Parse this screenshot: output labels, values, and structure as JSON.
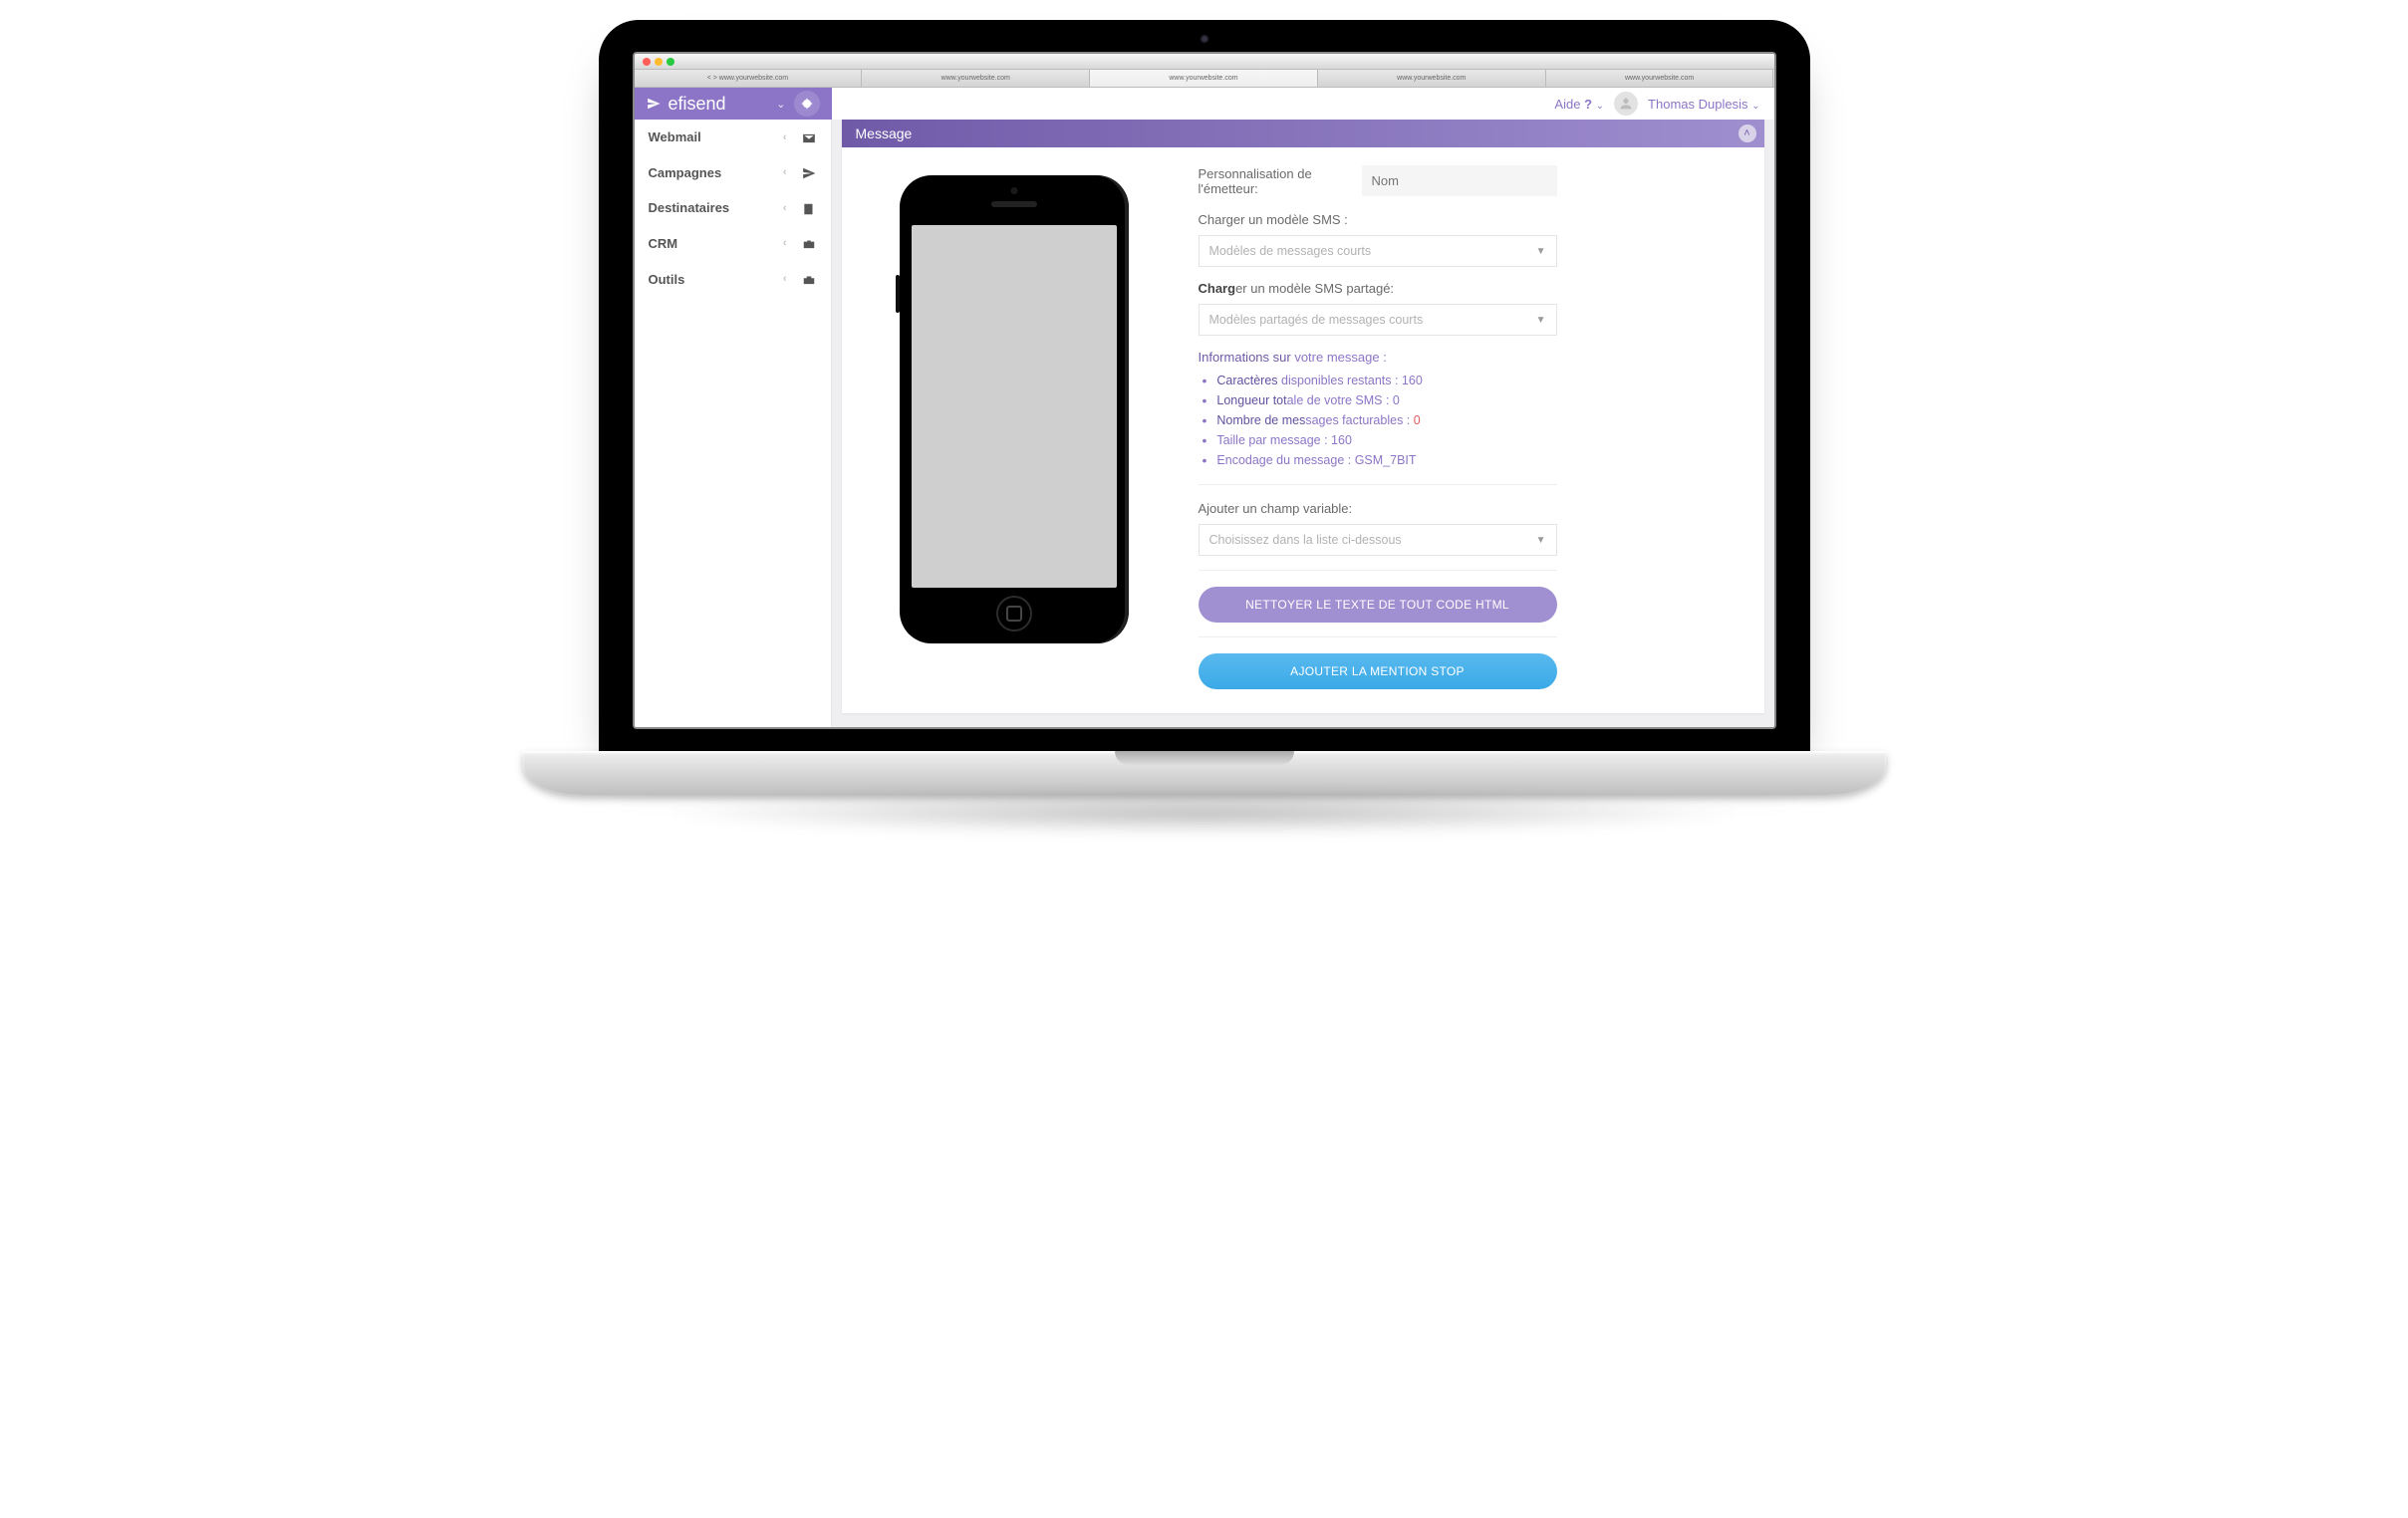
{
  "browser": {
    "tabs": [
      "< > www.yourwebsite.com",
      "www.yourwebsite.com",
      "www.yourwebsite.com",
      "www.yourwebsite.com",
      "www.yourwebsite.com"
    ]
  },
  "brand": "efisend",
  "topbar": {
    "help": "Aide",
    "user": "Thomas Duplesis"
  },
  "sidebar": {
    "items": [
      {
        "label": "Webmail"
      },
      {
        "label": "Campagnes"
      },
      {
        "label": "Destinataires"
      },
      {
        "label": "CRM"
      },
      {
        "label": "Outils"
      }
    ]
  },
  "panel": {
    "title": "Message"
  },
  "form": {
    "sender_label": "Personnalisation de l'émetteur:",
    "sender_placeholder": "Nom",
    "load_model_label": "Charger un modèle SMS :",
    "model_select_placeholder": "Modèles de messages courts",
    "load_shared_label": "Charger un modèle SMS partagé:",
    "shared_select_placeholder": "Modèles partagés de messages courts",
    "info_title": "Informations sur votre message :",
    "info": {
      "chars": "Caractères disponibles restants : 160",
      "length": "Longueur totale de votre SMS : 0",
      "billable_label": "Nombre de messages facturables : ",
      "billable_value": "0",
      "size": "Taille par message : 160",
      "encoding": "Encodage du message : GSM_7BIT"
    },
    "var_label": "Ajouter un champ variable:",
    "var_select_placeholder": "Choisissez dans la liste ci-dessous",
    "btn_clean": "NETTOYER LE TEXTE DE TOUT CODE HTML",
    "btn_stop": "AJOUTER LA MENTION STOP"
  }
}
